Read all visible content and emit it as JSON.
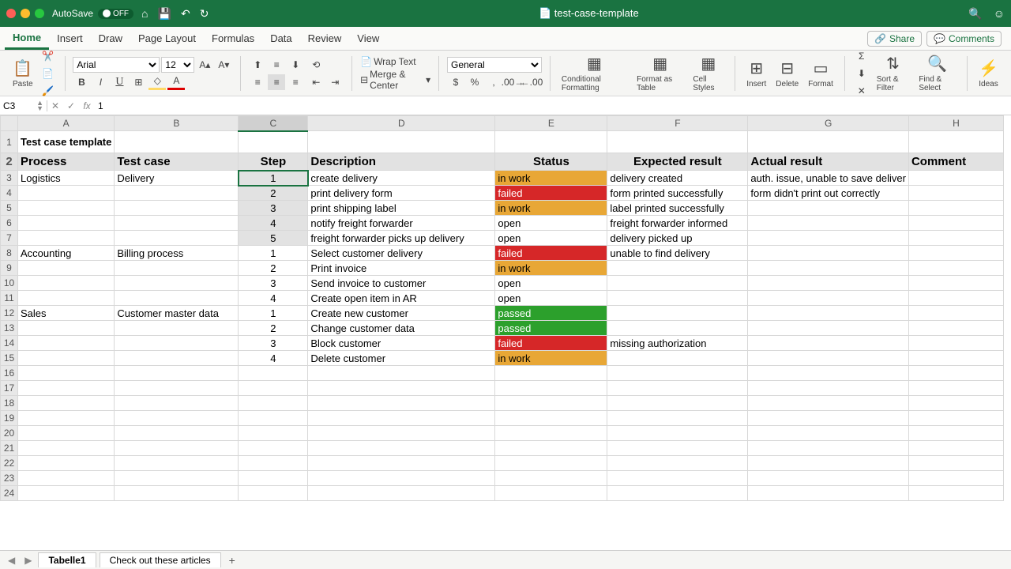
{
  "titlebar": {
    "autosave_label": "AutoSave",
    "autosave_state": "OFF",
    "filename": "test-case-template"
  },
  "ribbon_tabs": [
    "Home",
    "Insert",
    "Draw",
    "Page Layout",
    "Formulas",
    "Data",
    "Review",
    "View"
  ],
  "share_label": "Share",
  "comments_label": "Comments",
  "ribbon": {
    "paste": "Paste",
    "font_name": "Arial",
    "font_size": "12",
    "wrap": "Wrap Text",
    "merge": "Merge & Center",
    "numfmt": "General",
    "cond_fmt": "Conditional Formatting",
    "fmt_table": "Format as Table",
    "cell_styles": "Cell Styles",
    "insert": "Insert",
    "delete": "Delete",
    "format": "Format",
    "sort": "Sort & Filter",
    "find": "Find & Select",
    "ideas": "Ideas"
  },
  "formula": {
    "cell": "C3",
    "value": "1"
  },
  "columns": [
    "A",
    "B",
    "C",
    "D",
    "E",
    "F",
    "G",
    "H"
  ],
  "sheet": {
    "title": "Test case template",
    "headers": [
      "Process",
      "Test case",
      "Step",
      "Description",
      "Status",
      "Expected result",
      "Actual result",
      "Comment"
    ],
    "rows": [
      {
        "process": "Logistics",
        "testcase": "Delivery",
        "step": "1",
        "desc": "create delivery",
        "status": "in work",
        "status_cls": "inwork",
        "expected": "delivery created",
        "actual": "auth. issue, unable to save deliver",
        "comment": ""
      },
      {
        "process": "",
        "testcase": "",
        "step": "2",
        "desc": "print delivery form",
        "status": "failed",
        "status_cls": "failed",
        "expected": "form printed successfully",
        "actual": "form didn't print out correctly",
        "comment": ""
      },
      {
        "process": "",
        "testcase": "",
        "step": "3",
        "desc": "print shipping label",
        "status": "in work",
        "status_cls": "inwork",
        "expected": "label printed successfully",
        "actual": "",
        "comment": ""
      },
      {
        "process": "",
        "testcase": "",
        "step": "4",
        "desc": "notify freight forwarder",
        "status": "open",
        "status_cls": "open",
        "expected": "freight forwarder informed",
        "actual": "",
        "comment": ""
      },
      {
        "process": "",
        "testcase": "",
        "step": "5",
        "desc": "freight forwarder picks up delivery",
        "status": "open",
        "status_cls": "open",
        "expected": "delivery picked up",
        "actual": "",
        "comment": ""
      },
      {
        "process": "Accounting",
        "testcase": "Billing process",
        "step": "1",
        "desc": "Select customer delivery",
        "status": "failed",
        "status_cls": "failed",
        "expected": "unable to find delivery",
        "actual": "",
        "comment": ""
      },
      {
        "process": "",
        "testcase": "",
        "step": "2",
        "desc": "Print invoice",
        "status": "in work",
        "status_cls": "inwork",
        "expected": "",
        "actual": "",
        "comment": ""
      },
      {
        "process": "",
        "testcase": "",
        "step": "3",
        "desc": "Send invoice to customer",
        "status": "open",
        "status_cls": "open",
        "expected": "",
        "actual": "",
        "comment": ""
      },
      {
        "process": "",
        "testcase": "",
        "step": "4",
        "desc": "Create open item in AR",
        "status": "open",
        "status_cls": "open",
        "expected": "",
        "actual": "",
        "comment": ""
      },
      {
        "process": "Sales",
        "testcase": "Customer master data",
        "step": "1",
        "desc": "Create new customer",
        "status": "passed",
        "status_cls": "passed",
        "expected": "",
        "actual": "",
        "comment": ""
      },
      {
        "process": "",
        "testcase": "",
        "step": "2",
        "desc": "Change customer data",
        "status": "passed",
        "status_cls": "passed",
        "expected": "",
        "actual": "",
        "comment": ""
      },
      {
        "process": "",
        "testcase": "",
        "step": "3",
        "desc": "Block customer",
        "status": "failed",
        "status_cls": "failed",
        "expected": "missing authorization",
        "actual": "",
        "comment": ""
      },
      {
        "process": "",
        "testcase": "",
        "step": "4",
        "desc": "Delete customer",
        "status": "in work",
        "status_cls": "inwork",
        "expected": "",
        "actual": "",
        "comment": ""
      }
    ]
  },
  "sheet_tabs": [
    "Tabelle1",
    "Check out these articles"
  ]
}
